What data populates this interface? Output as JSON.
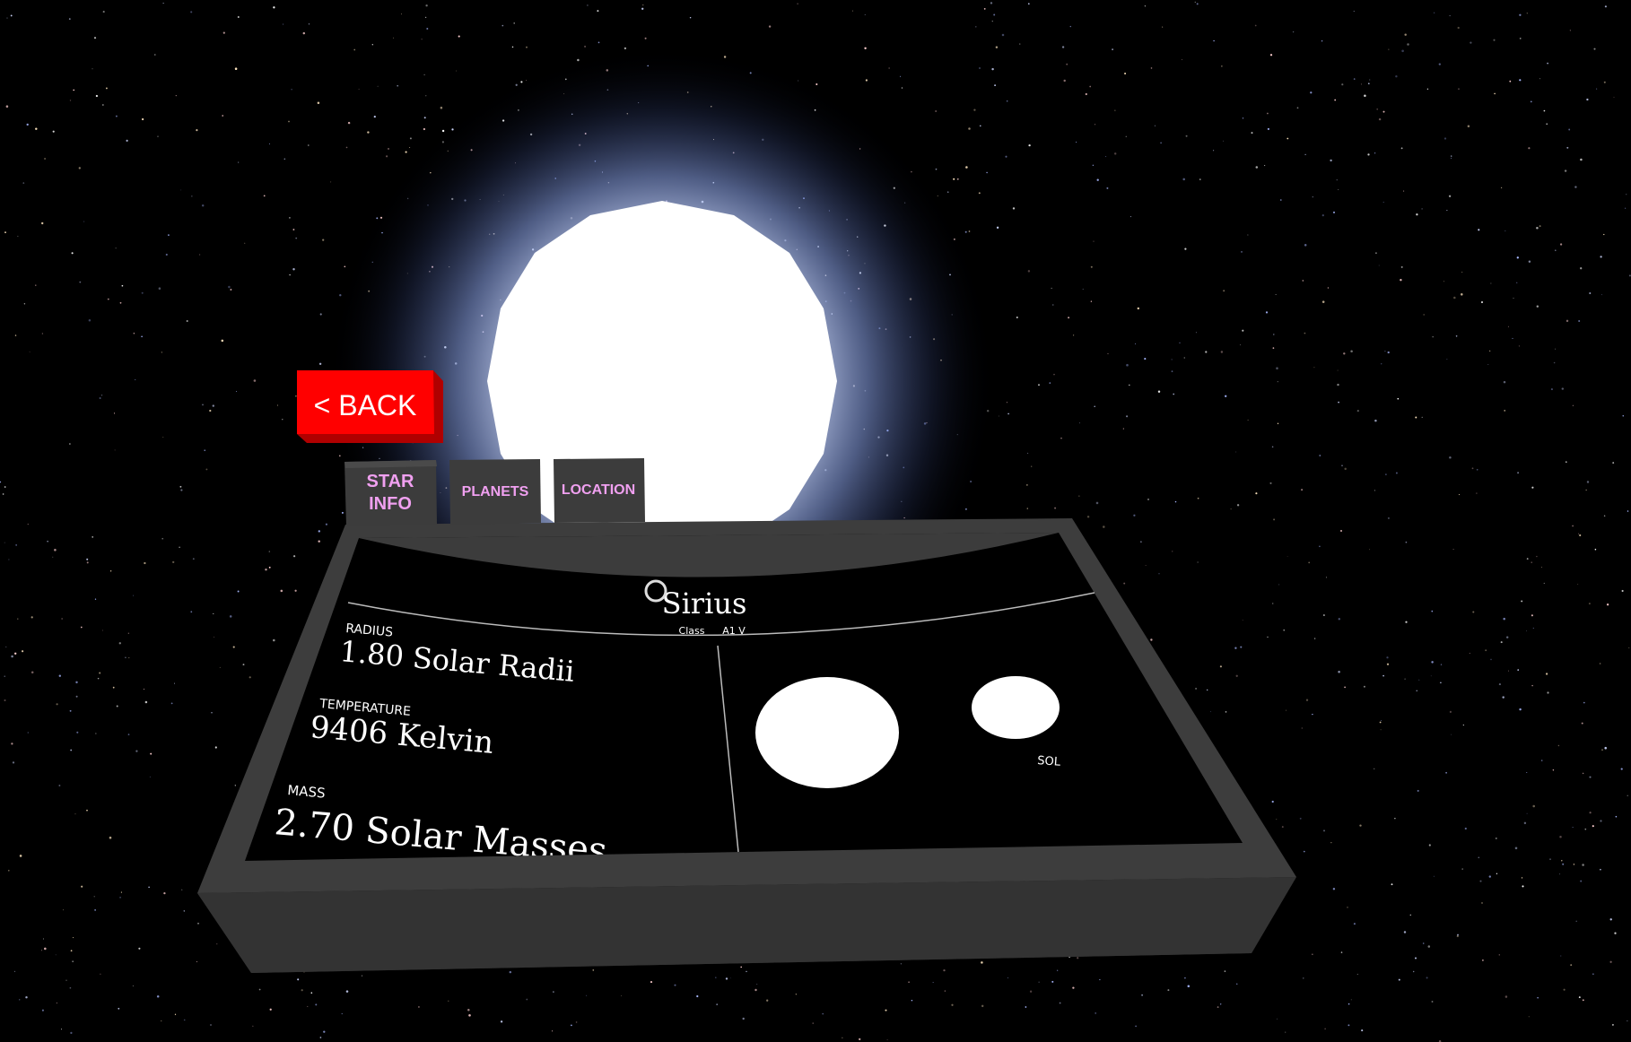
{
  "back_button": {
    "label": "< BACK",
    "color": "#ff0000"
  },
  "tabs": {
    "star_info": {
      "line1": "STAR",
      "line2": "INFO"
    },
    "planets": {
      "label": "PLANETS"
    },
    "location": {
      "label": "LOCATION"
    }
  },
  "tab_text_color": "#f0a0f0",
  "star": {
    "name": "Sirius",
    "class_label": "Class",
    "class_value": "A1 V"
  },
  "stats": {
    "radius": {
      "label": "RADIUS",
      "value": "1.80 Solar Radii"
    },
    "temperature": {
      "label": "TEMPERATURE",
      "value": "9406 Kelvin"
    },
    "mass": {
      "label": "MASS",
      "value": "2.70 Solar Masses"
    }
  },
  "comparison": {
    "sun_label": "SOL"
  },
  "colors": {
    "star_glow": "#9fb8ff",
    "console": "#3a3a3a",
    "screen": "#000000"
  },
  "icons": {
    "gaze_cursor": "ring-cursor-icon"
  }
}
